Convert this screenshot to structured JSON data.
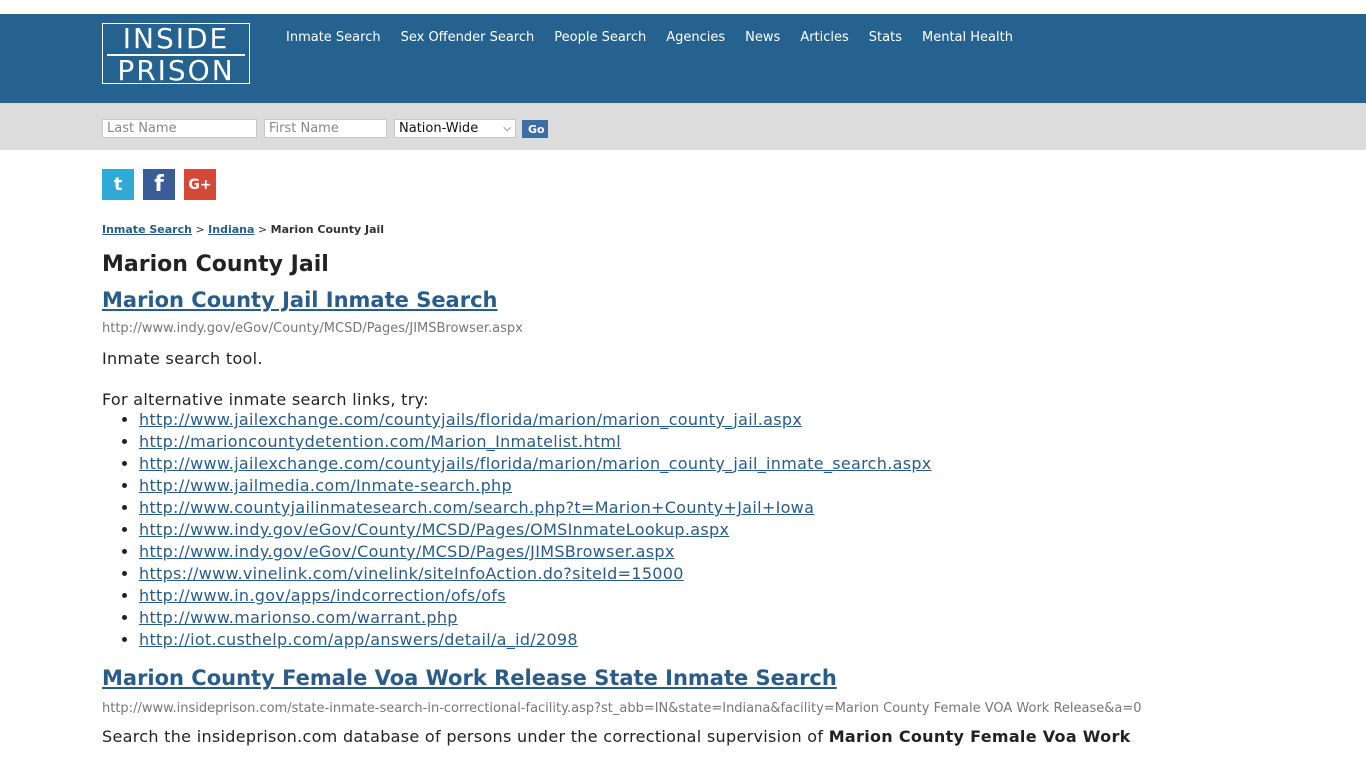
{
  "header": {
    "logo_line1": "INSIDE",
    "logo_line2": "PRISON",
    "nav": [
      {
        "label": "Inmate Search"
      },
      {
        "label": "Sex Offender Search"
      },
      {
        "label": "People Search"
      },
      {
        "label": "Agencies"
      },
      {
        "label": "News"
      },
      {
        "label": "Articles"
      },
      {
        "label": "Stats"
      },
      {
        "label": "Mental Health"
      }
    ]
  },
  "search": {
    "last_name_placeholder": "Last Name",
    "first_name_placeholder": "First Name",
    "region_selected": "Nation-Wide",
    "go_label": "Go"
  },
  "social": {
    "twitter_glyph": "t",
    "facebook_glyph": "f",
    "google_glyph": "G+"
  },
  "breadcrumb": {
    "item1": "Inmate Search",
    "sep": ">",
    "item2": "Indiana",
    "current": "Marion County Jail"
  },
  "page": {
    "title": "Marion County Jail",
    "result1": {
      "title": "Marion County Jail Inmate Search",
      "url": "http://www.indy.gov/eGov/County/MCSD/Pages/JIMSBrowser.aspx",
      "desc": "Inmate search tool.",
      "alt_intro": "For alternative inmate search links, try:",
      "links": [
        "http://www.jailexchange.com/countyjails/florida/marion/marion_county_jail.aspx",
        "http://marioncountydetention.com/Marion_Inmatelist.html",
        "http://www.jailexchange.com/countyjails/florida/marion/marion_county_jail_inmate_search.aspx",
        "http://www.jailmedia.com/Inmate-search.php",
        "http://www.countyjailinmatesearch.com/search.php?t=Marion+County+Jail+Iowa",
        "http://www.indy.gov/eGov/County/MCSD/Pages/OMSInmateLookup.aspx",
        "http://www.indy.gov/eGov/County/MCSD/Pages/JIMSBrowser.aspx",
        "https://www.vinelink.com/vinelink/siteInfoAction.do?siteId=15000",
        "http://www.in.gov/apps/indcorrection/ofs/ofs",
        "http://www.marionso.com/warrant.php",
        "http://iot.custhelp.com/app/answers/detail/a_id/2098"
      ]
    },
    "result2": {
      "title": "Marion County Female Voa Work Release State Inmate Search",
      "url": "http://www.insideprison.com/state-inmate-search-in-correctional-facility.asp?st_abb=IN&state=Indiana&facility=Marion County Female VOA Work Release&a=0",
      "desc_prefix": "Search the insideprison.com database of persons under the correctional supervision of ",
      "desc_bold": "Marion County Female Voa Work"
    }
  }
}
